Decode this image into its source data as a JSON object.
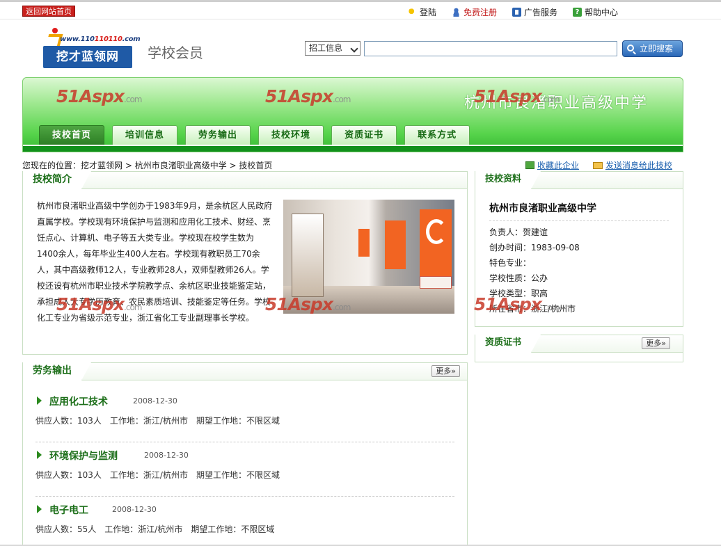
{
  "topbar": {
    "back_home": "返回网站首页",
    "login": "登陆",
    "register": "免费注册",
    "ads": "广告服务",
    "help": "帮助中心"
  },
  "header": {
    "logo_url_a": "www.110",
    "logo_url_b": "110110",
    "logo_url_c": ".com",
    "logo_name": "挖才蓝领网",
    "section": "学校会员",
    "search_select": "招工信息",
    "search_button": "立即搜索"
  },
  "banner": {
    "school_title": "杭州市良渚职业高级中学",
    "watermark_main": "51Aspx",
    "watermark_suffix": ".com",
    "tabs": [
      "技校首页",
      "培训信息",
      "劳务输出",
      "技校环境",
      "资质证书",
      "联系方式"
    ]
  },
  "breadcrumb": {
    "prefix": "您现在的位置：",
    "site": "挖才蓝领网",
    "sep": " > ",
    "school": "杭州市良渚职业高级中学",
    "page": "技校首页",
    "favorite": "收藏此企业",
    "message": "发送消息给此技校"
  },
  "intro": {
    "title": "技校简介",
    "text": "杭州市良渚职业高级中学创办于1983年9月，是余杭区人民政府直属学校。学校现有环境保护与监测和应用化工技术、财经、烹饪点心、计算机、电子等五大类专业。学校现在校学生数为1400余人，每年毕业生400人左右。学校现有教职员工70余人，其中高级教师12人，专业教师28人，双师型教师26人。学校还设有杭州市职业技术学院教学点、余杭区职业技能鉴定站，承担成人大专学历教育、农民素质培训、技能鉴定等任务。学校化工专业为省级示范专业，浙江省化工专业副理事长学校。"
  },
  "labor": {
    "title": "劳务输出",
    "more": "更多»",
    "items": [
      {
        "title": "应用化工技术",
        "date": "2008-12-30",
        "supply": "供应人数：103人",
        "work": "工作地：浙江/杭州市",
        "expect": "期望工作地：不限区域"
      },
      {
        "title": "环境保护与监测",
        "date": "2008-12-30",
        "supply": "供应人数：103人",
        "work": "工作地：浙江/杭州市",
        "expect": "期望工作地：不限区域"
      },
      {
        "title": "电子电工",
        "date": "2008-12-30",
        "supply": "供应人数：55人",
        "work": "工作地：浙江/杭州市",
        "expect": "期望工作地：不限区域"
      }
    ]
  },
  "sidebar": {
    "info_title": "技校资料",
    "school_name": "杭州市良渚职业高级中学",
    "rows": [
      "负责人：贺建谊",
      "创办时间：1983-09-08",
      "特色专业：",
      "学校性质：公办",
      "学校类型：职高",
      "所在省市：浙江/杭州市"
    ],
    "cert_title": "资质证书",
    "cert_more": "更多»"
  }
}
